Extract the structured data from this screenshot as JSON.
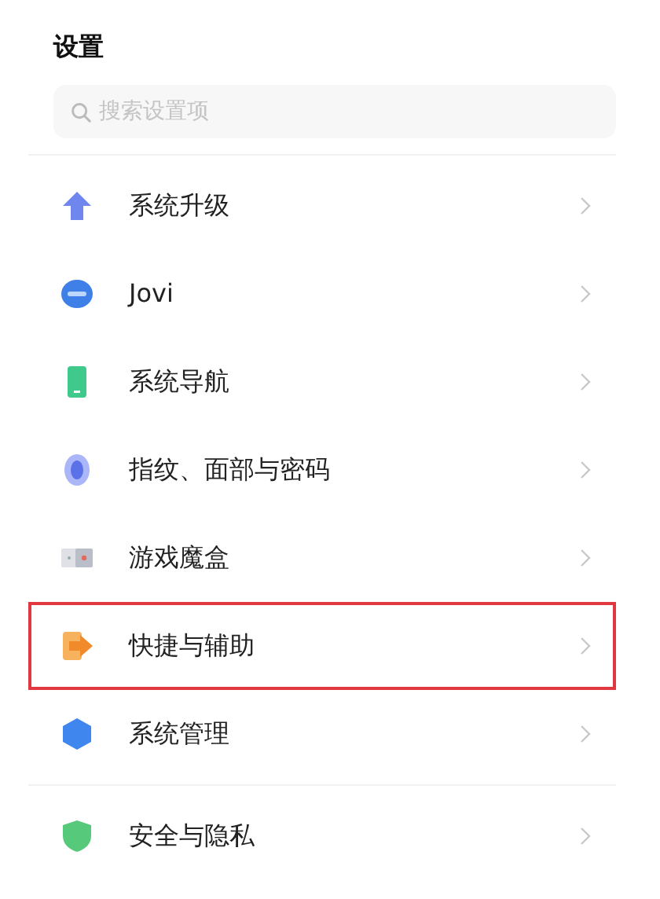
{
  "title": "设置",
  "search": {
    "placeholder": "搜索设置项"
  },
  "groups": [
    {
      "items": [
        {
          "label": "系统升级",
          "kind": "upgrade",
          "highlighted": false
        },
        {
          "label": "Jovi",
          "kind": "jovi",
          "highlighted": false
        },
        {
          "label": "系统导航",
          "kind": "navigation",
          "highlighted": false
        },
        {
          "label": "指纹、面部与密码",
          "kind": "fingerprint",
          "highlighted": false
        },
        {
          "label": "游戏魔盒",
          "kind": "game",
          "highlighted": false
        },
        {
          "label": "快捷与辅助",
          "kind": "shortcut",
          "highlighted": true
        },
        {
          "label": "系统管理",
          "kind": "system",
          "highlighted": false
        }
      ]
    },
    {
      "items": [
        {
          "label": "安全与隐私",
          "kind": "security",
          "highlighted": false
        }
      ]
    }
  ]
}
